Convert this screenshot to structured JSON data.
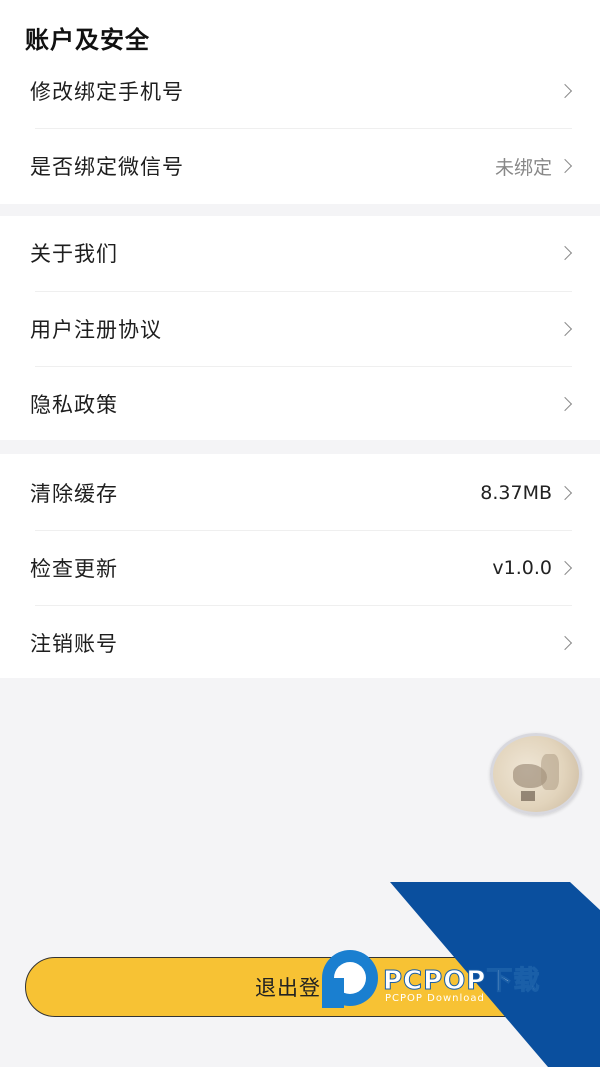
{
  "section_account": {
    "title": "账户及安全",
    "rows": [
      {
        "label": "修改绑定手机号",
        "value": ""
      },
      {
        "label": "是否绑定微信号",
        "value": "未绑定"
      }
    ]
  },
  "section_about": {
    "rows": [
      {
        "label": "关于我们"
      },
      {
        "label": "用户注册协议"
      },
      {
        "label": "隐私政策"
      }
    ]
  },
  "section_misc": {
    "rows": [
      {
        "label": "清除缓存",
        "value": "8.37MB"
      },
      {
        "label": "检查更新",
        "value": "v1.0.0"
      },
      {
        "label": "注销账号",
        "value": ""
      }
    ]
  },
  "logout": {
    "label": "退出登录"
  },
  "watermark": {
    "brand": "PCPOP下载",
    "sub": "PCPOP Download"
  },
  "colors": {
    "accent": "#f7c234",
    "background": "#f4f4f6",
    "card": "#ffffff",
    "watermark_blue": "#0a4f9e",
    "watermark_logo": "#1a7fd0"
  },
  "icons": {
    "row_arrow": "chevron-right-icon",
    "floating": "floating-avatar-icon",
    "watermark": "pcpop-logo-icon"
  }
}
